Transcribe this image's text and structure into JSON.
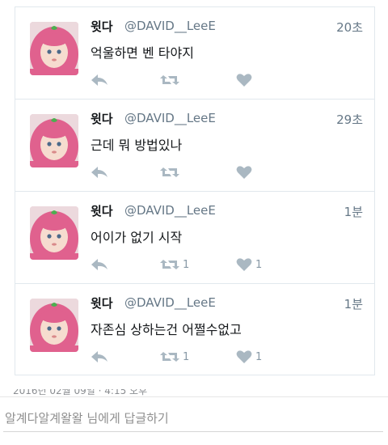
{
  "tweets": [
    {
      "name": "윗다",
      "handle": "@DAVID__LeeE",
      "time": "20초",
      "text": "억울하면 벤 타야지",
      "retweets": "",
      "likes": ""
    },
    {
      "name": "윗다",
      "handle": "@DAVID__LeeE",
      "time": "29초",
      "text": "근데 뭐 방법있나",
      "retweets": "",
      "likes": ""
    },
    {
      "name": "윗다",
      "handle": "@DAVID__LeeE",
      "time": "1분",
      "text": "어이가 없기 시작",
      "retweets": "1",
      "likes": "1"
    },
    {
      "name": "윗다",
      "handle": "@DAVID__LeeE",
      "time": "1분",
      "text": "자존심 상하는건 어쩔수없고",
      "retweets": "1",
      "likes": "1"
    }
  ],
  "footer": {
    "date": "2016년 02월 09일 · 4:15 오후",
    "reply_placeholder": "알계다알계왈왈 님에게 답글하기"
  },
  "colors": {
    "icon": "#aab8c2",
    "border": "#e1e8ed",
    "muted": "#657786"
  },
  "icons": {
    "reply": "reply-arrow-icon",
    "retweet": "retweet-icon",
    "like": "heart-icon"
  }
}
